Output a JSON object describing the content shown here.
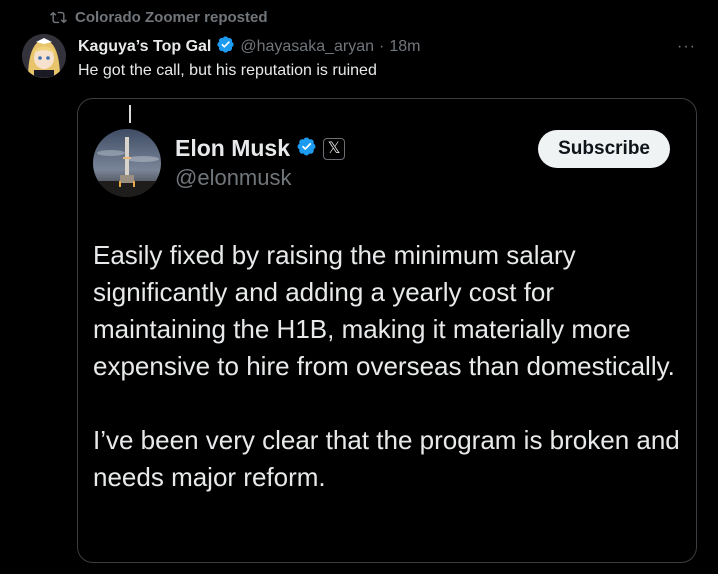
{
  "repost": {
    "icon": "repost-icon",
    "text": "Colorado Zoomer reposted"
  },
  "tweet": {
    "avatar_icon": "anime-avatar",
    "author_name": "Kaguya’s Top Gal",
    "verified_icon": "verified-badge-icon",
    "handle": "@hayasaka_aryan",
    "separator": "·",
    "time": "18m",
    "more_label": "···",
    "text": "He got the call, but his reputation is ruined"
  },
  "quote": {
    "avatar_icon": "rocket-avatar",
    "name": "Elon Musk",
    "verified_icon": "verified-badge-icon",
    "affiliate_badge": "𝕏",
    "handle": "@elonmusk",
    "subscribe_label": "Subscribe",
    "paragraphs": [
      "Easily fixed by raising the minimum salary significantly and adding a yearly cost for maintaining the H1B, making it materially more expensive to hire from overseas than domestically.",
      "I’ve been very clear that the program is broken and needs major reform."
    ]
  },
  "colors": {
    "background": "#000000",
    "text": "#e7e9ea",
    "muted": "#71767b",
    "verified": "#1d9bf0",
    "border": "#3a3d41"
  }
}
